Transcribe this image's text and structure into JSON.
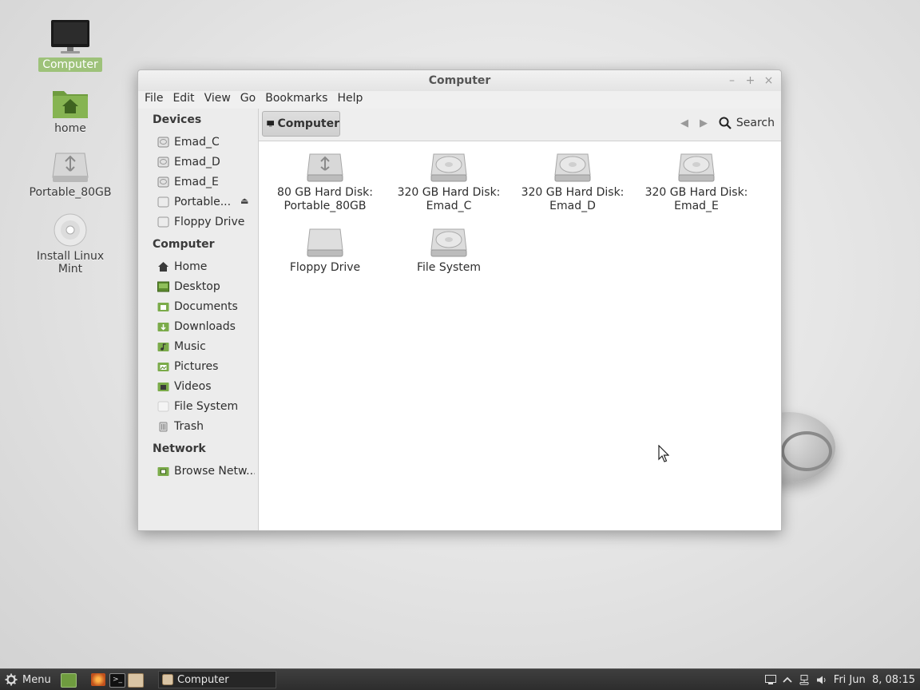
{
  "desktop": {
    "icons": [
      {
        "label": "Computer",
        "icon": "monitor-icon"
      },
      {
        "label": "home",
        "icon": "home-folder-icon"
      },
      {
        "label": "Portable_80GB",
        "icon": "usb-drive-icon"
      },
      {
        "label": "Install Linux Mint",
        "icon": "optical-disc-icon"
      }
    ]
  },
  "window": {
    "title": "Computer",
    "controls": {
      "minimize": "–",
      "maximize": "+",
      "close": "×"
    },
    "menu": [
      "File",
      "Edit",
      "View",
      "Go",
      "Bookmarks",
      "Help"
    ],
    "toolbar": {
      "location": "Computer",
      "back": "◀",
      "forward": "▶",
      "search_label": "Search"
    },
    "sidebar": {
      "devices_title": "Devices",
      "devices": [
        "Emad_C",
        "Emad_D",
        "Emad_E",
        "Portable...",
        "Floppy Drive"
      ],
      "eject": "⏏",
      "computer_title": "Computer",
      "computer": [
        "Home",
        "Desktop",
        "Documents",
        "Downloads",
        "Music",
        "Pictures",
        "Videos",
        "File System",
        "Trash"
      ],
      "network_title": "Network",
      "network": [
        "Browse Netw..."
      ]
    },
    "drives": [
      {
        "line1": "80 GB Hard Disk:",
        "line2": "Portable_80GB",
        "icon": "usb-drive-icon"
      },
      {
        "line1": "320 GB Hard Disk:",
        "line2": "Emad_C",
        "icon": "hard-disk-icon"
      },
      {
        "line1": "320 GB Hard Disk:",
        "line2": "Emad_D",
        "icon": "hard-disk-icon"
      },
      {
        "line1": "320 GB Hard Disk:",
        "line2": "Emad_E",
        "icon": "hard-disk-icon"
      },
      {
        "line1": "Floppy Drive",
        "line2": "",
        "icon": "floppy-drive-icon"
      },
      {
        "line1": "File System",
        "line2": "",
        "icon": "hard-disk-icon"
      }
    ]
  },
  "taskbar": {
    "menu_label": "Menu",
    "task_label": "Computer",
    "clock": "Fri Jun  8, 08:15"
  },
  "colors": {
    "accent": "#9ec27a",
    "folder_green": "#7bab4a",
    "taskbar": "#333333"
  }
}
